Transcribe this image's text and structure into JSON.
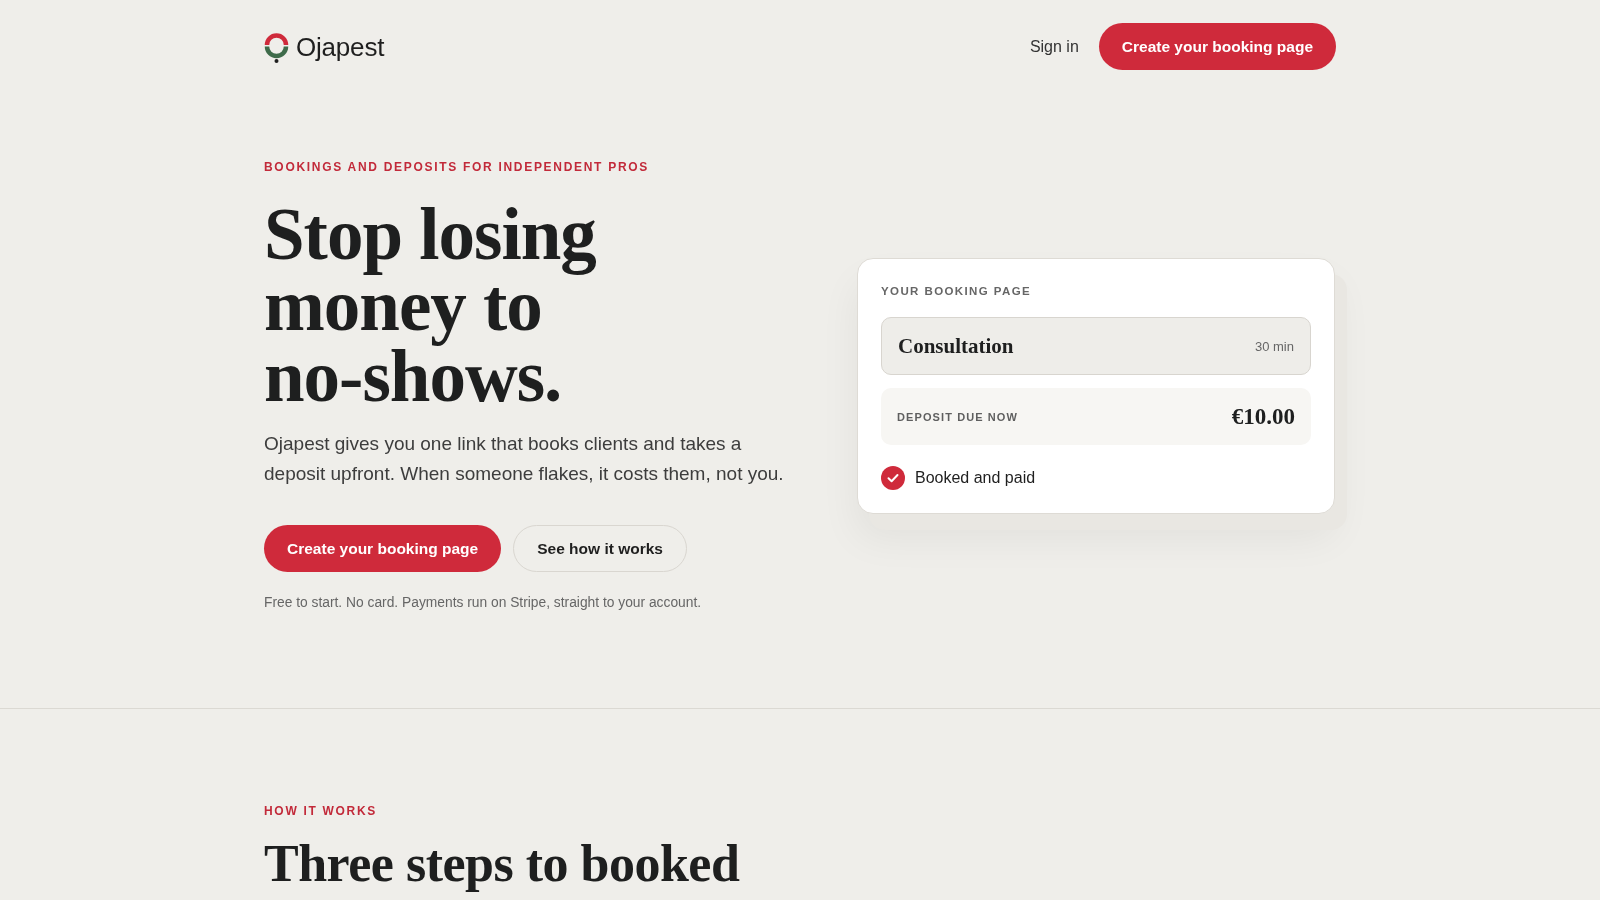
{
  "header": {
    "logo": {
      "text": "Ojapest"
    },
    "nav": [
      {
        "label": "Sign in",
        "kind": "link"
      },
      {
        "label": "Create your booking page",
        "kind": "primary"
      }
    ]
  },
  "hero": {
    "eyebrow": "BOOKINGS AND DEPOSITS FOR INDEPENDENT PROS",
    "headline": "Stop losing money to no-shows.",
    "intro": "Ojapest gives you one link that books clients and takes a deposit upfront. When someone flakes, it costs them, not you.",
    "actions": [
      {
        "label": "Create your booking page",
        "kind": "primary"
      },
      {
        "label": "See how it works",
        "kind": "secondary"
      }
    ],
    "footnote": "Free to start. No card. Payments run on Stripe, straight to your account."
  },
  "booking_card": {
    "label": "YOUR BOOKING PAGE",
    "service": {
      "name": "Consultation",
      "duration": "30 min"
    },
    "deposit": {
      "label": "DEPOSIT DUE NOW",
      "amount": "€10.00"
    },
    "status": "Booked and paid"
  },
  "how_it_works": {
    "eyebrow": "HOW IT WORKS",
    "heading": "Three steps to booked"
  }
}
